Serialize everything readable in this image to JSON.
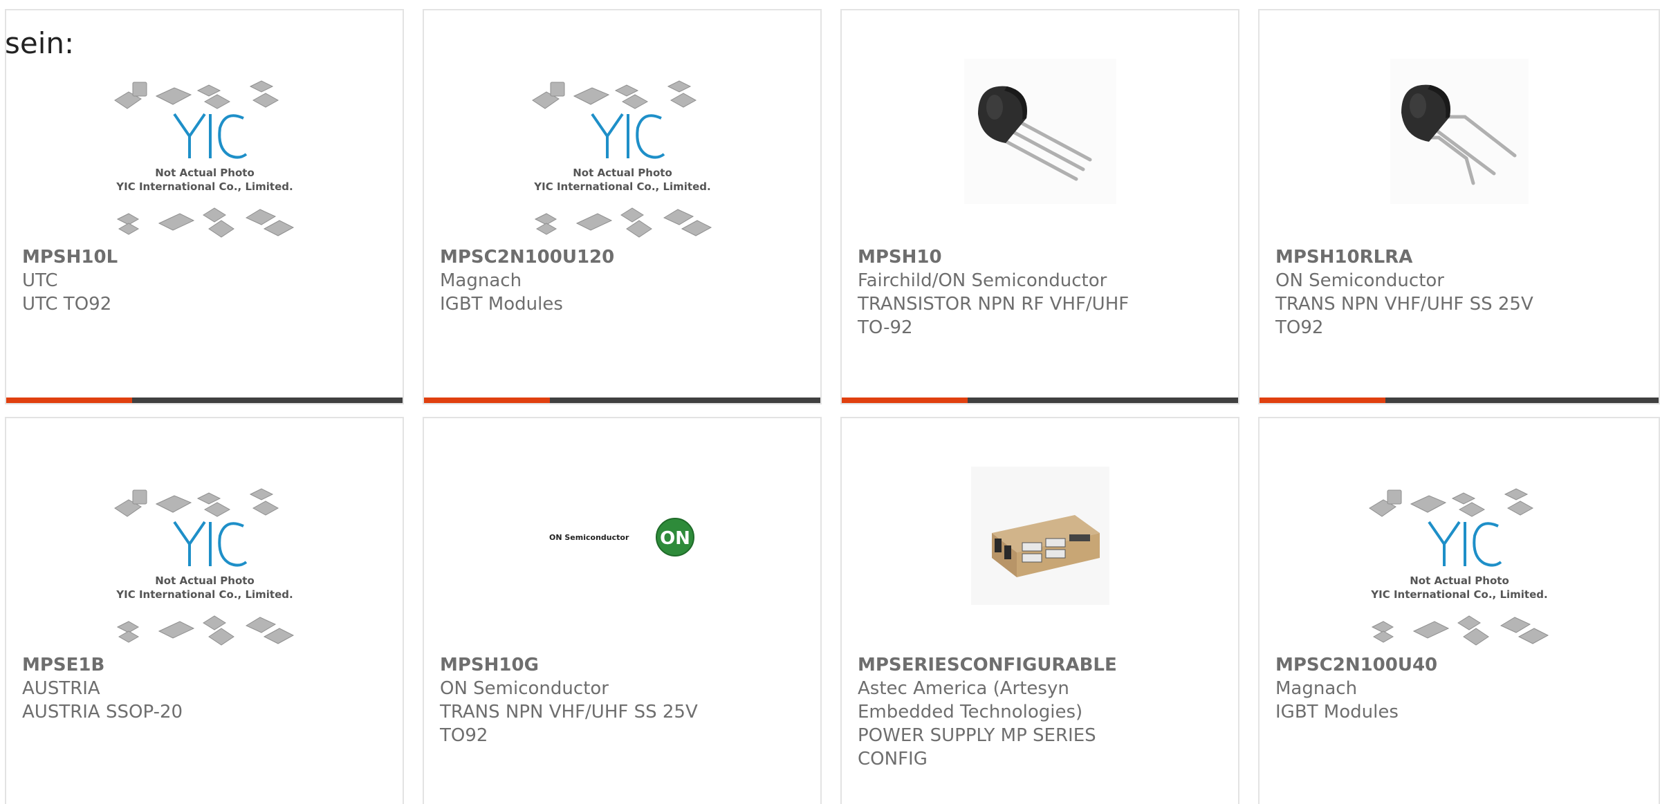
{
  "intro_text": "sein:",
  "placeholder": {
    "line1": "Not Actual Photo",
    "line2": "YIC International Co., Limited."
  },
  "logo_text": "ON Semiconductor",
  "logo_badge": "ON",
  "colors": {
    "accent": "#e0400f",
    "bar": "#404040",
    "text": "#6e6e6e",
    "yic_blue": "#1e8fc8",
    "on_green": "#2e8b3a"
  },
  "cards": [
    {
      "part": "MPSH10L",
      "maker": "UTC",
      "desc": "UTC TO92",
      "image": "yic-placeholder"
    },
    {
      "part": "MPSC2N100U120",
      "maker": "Magnach",
      "desc": "IGBT Modules",
      "image": "yic-placeholder"
    },
    {
      "part": "MPSH10",
      "maker": "Fairchild/ON Semiconductor",
      "desc": "TRANSISTOR NPN RF VHF/UHF TO-92",
      "image": "to92-transistor"
    },
    {
      "part": "MPSH10RLRA",
      "maker": "ON Semiconductor",
      "desc": "TRANS NPN VHF/UHF SS 25V TO92",
      "image": "to92-transistor-bent"
    },
    {
      "part": "MPSE1B",
      "maker": "AUSTRIA",
      "desc": "AUSTRIA SSOP-20",
      "image": "yic-placeholder"
    },
    {
      "part": "MPSH10G",
      "maker": "ON Semiconductor",
      "desc": "TRANS NPN VHF/UHF SS 25V TO92",
      "image": "on-semi-logo"
    },
    {
      "part": "MPSERIESCONFIGURABLE",
      "maker": "Astec America (Artesyn Embedded Technologies)",
      "desc": "POWER SUPPLY MP SERIES CONFIG",
      "image": "power-supply"
    },
    {
      "part": "MPSC2N100U40",
      "maker": "Magnach",
      "desc": "IGBT Modules",
      "image": "yic-placeholder"
    }
  ]
}
